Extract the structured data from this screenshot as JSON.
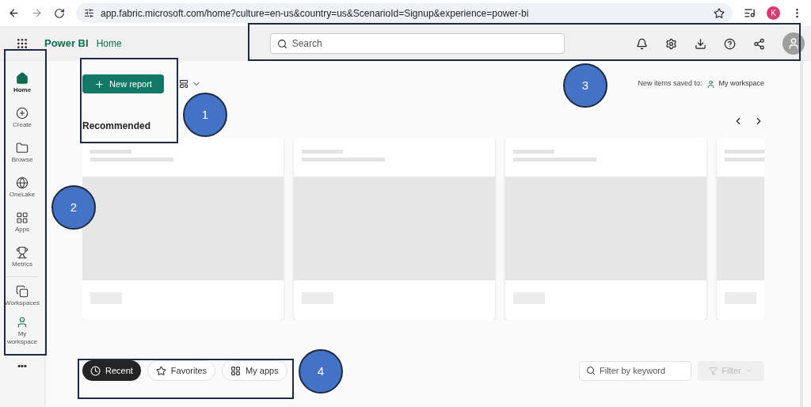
{
  "browser": {
    "url": "app.fabric.microsoft.com/home?culture=en-us&country=us&ScenarioId=Signup&experience=power-bi",
    "profile_initial": "K"
  },
  "header": {
    "app_name": "Power BI",
    "breadcrumb": "Home",
    "search": {
      "placeholder": "Search"
    }
  },
  "nav": {
    "items": [
      {
        "label": "Home",
        "selected": true
      },
      {
        "label": "Create",
        "selected": false
      },
      {
        "label": "Browse",
        "selected": false
      },
      {
        "label": "OneLake",
        "selected": false
      },
      {
        "label": "Apps",
        "selected": false
      },
      {
        "label": "Metrics",
        "selected": false
      },
      {
        "label": "Workspaces",
        "selected": false
      },
      {
        "label": "My workspace",
        "selected": false
      }
    ],
    "more": "•••"
  },
  "toolbar": {
    "new_report": "New report",
    "saved_to_label": "New items saved to:",
    "saved_to_workspace": "My workspace"
  },
  "recommended": {
    "title": "Recommended",
    "cards": [
      {
        "kind": "skeleton"
      },
      {
        "kind": "skeleton"
      },
      {
        "kind": "skeleton"
      },
      {
        "kind": "skeleton"
      }
    ]
  },
  "tabs": [
    {
      "label": "Recent",
      "selected": true
    },
    {
      "label": "Favorites",
      "selected": false
    },
    {
      "label": "My apps",
      "selected": false
    }
  ],
  "filter": {
    "placeholder": "Filter by keyword",
    "button": "Filter",
    "disabled": true
  },
  "annotations": [
    {
      "label": "1"
    },
    {
      "label": "2"
    },
    {
      "label": "3"
    },
    {
      "label": "4"
    }
  ]
}
